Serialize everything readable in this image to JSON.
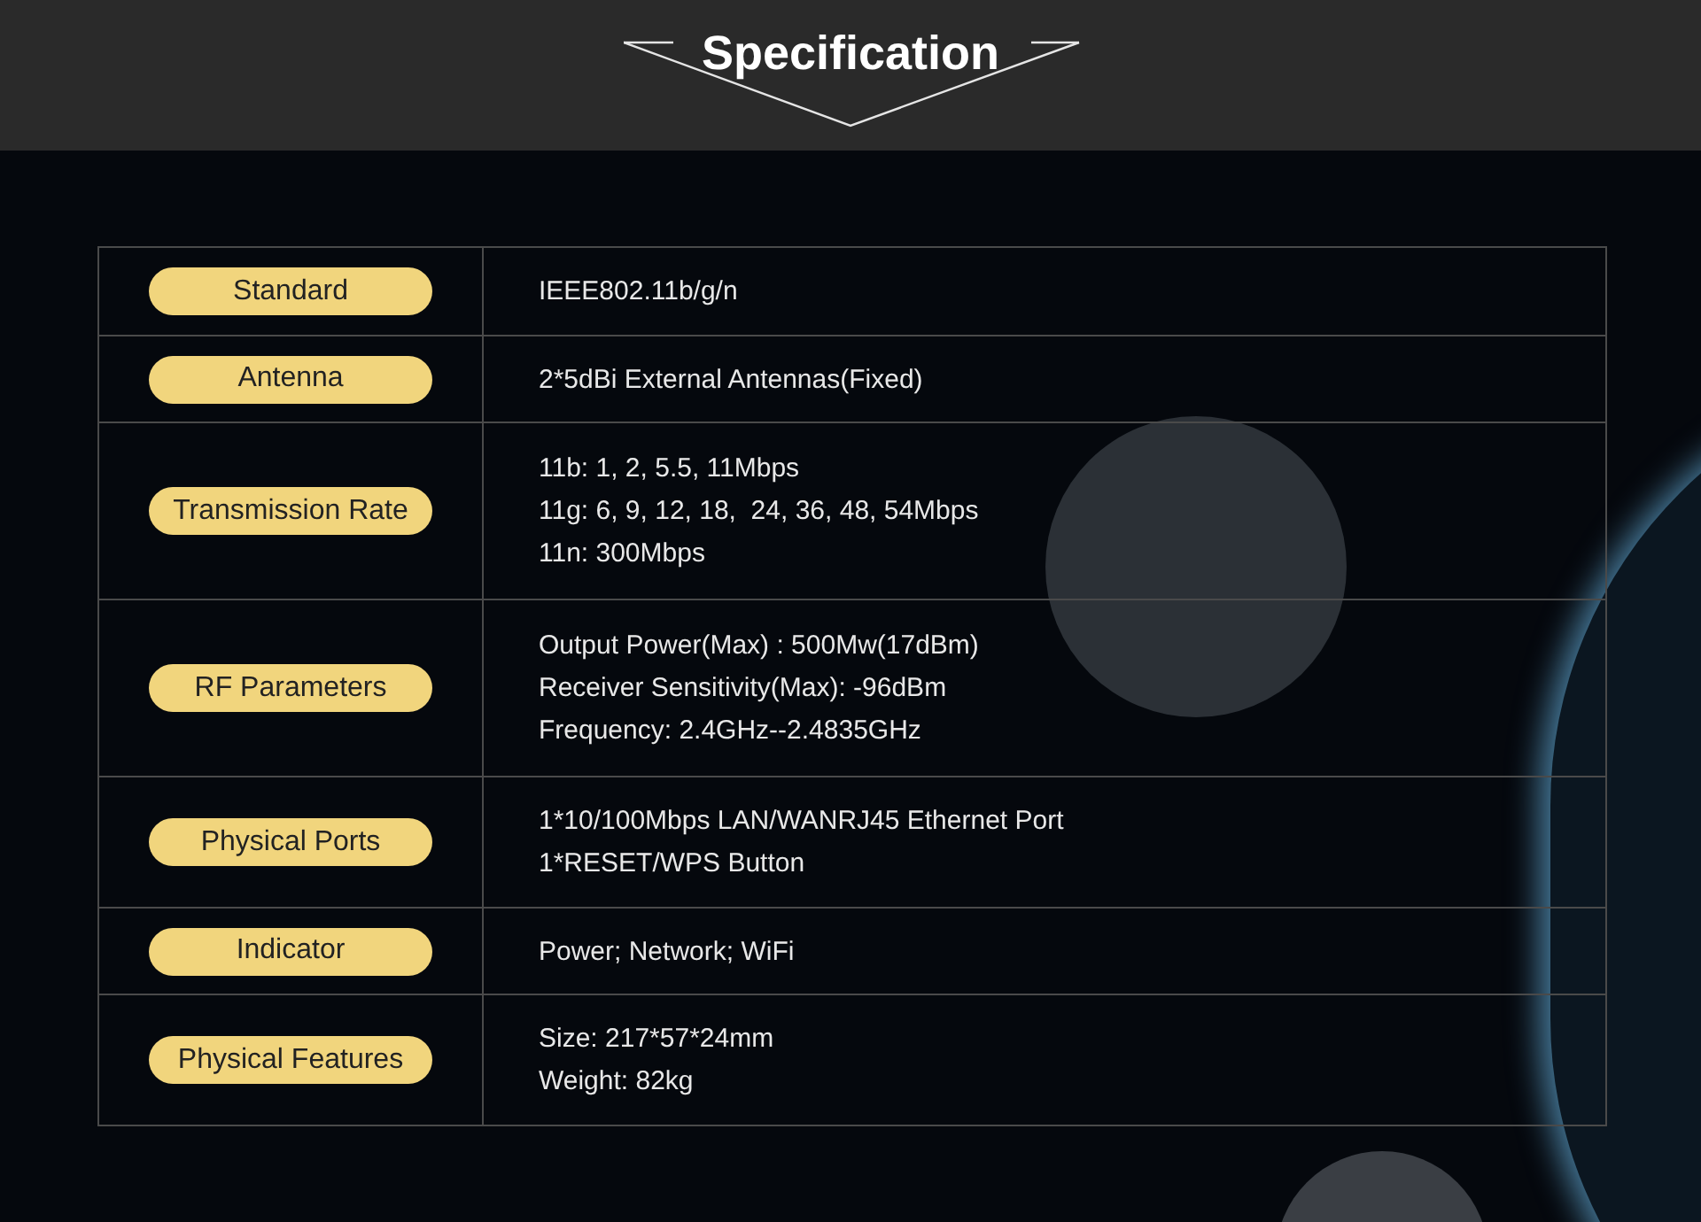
{
  "header": {
    "title": "Specification"
  },
  "specs": [
    {
      "label": "Standard",
      "lines": [
        "IEEE802.11b/g/n"
      ]
    },
    {
      "label": "Antenna",
      "lines": [
        "2*5dBi External Antennas(Fixed)"
      ]
    },
    {
      "label": "Transmission Rate",
      "lines": [
        "11b: 1, 2, 5.5, 11Mbps",
        "11g: 6, 9, 12, 18,  24, 36, 48, 54Mbps",
        "11n: 300Mbps"
      ]
    },
    {
      "label": "RF Parameters",
      "lines": [
        "Output Power(Max) : 500Mw(17dBm)",
        "Receiver Sensitivity(Max): -96dBm",
        "Frequency: 2.4GHz--2.4835GHz"
      ]
    },
    {
      "label": "Physical Ports",
      "lines": [
        "1*10/100Mbps LAN/WANRJ45 Ethernet Port",
        "1*RESET/WPS Button"
      ]
    },
    {
      "label": "Indicator",
      "lines": [
        "Power; Network; WiFi"
      ]
    },
    {
      "label": "Physical Features",
      "lines": [
        "Size: 217*57*24mm",
        "Weight: 82kg"
      ]
    }
  ]
}
